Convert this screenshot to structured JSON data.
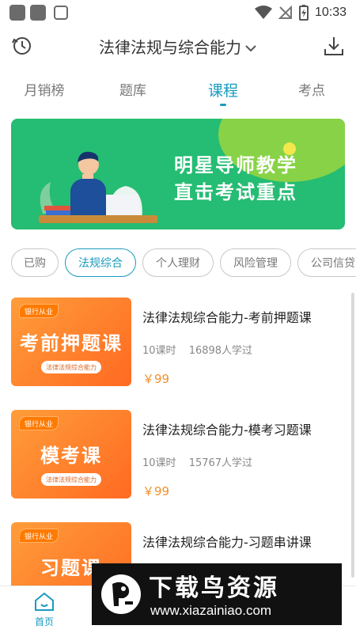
{
  "status_bar": {
    "time": "10:33",
    "icons": [
      "app-square-icon",
      "app-square-icon",
      "shield-icon",
      "wifi-icon",
      "no-signal-icon",
      "battery-charging-icon"
    ]
  },
  "header": {
    "title": "法律法规与综合能力",
    "left_icon": "history-icon",
    "right_icon": "download-icon",
    "title_chevron": "chevron-down-icon"
  },
  "tabs": [
    {
      "label": "月销榜",
      "active": false
    },
    {
      "label": "题库",
      "active": false
    },
    {
      "label": "课程",
      "active": true
    },
    {
      "label": "考点",
      "active": false
    }
  ],
  "banner": {
    "line1": "明星导师教学",
    "line2": "直击考试重点",
    "colors": {
      "background": "#25bc73",
      "accent": "#9ad63f"
    }
  },
  "filters": [
    {
      "label": "已购",
      "active": false
    },
    {
      "label": "法规综合",
      "active": true
    },
    {
      "label": "个人理财",
      "active": false
    },
    {
      "label": "风险管理",
      "active": false
    },
    {
      "label": "公司信贷",
      "active": false
    }
  ],
  "courses": [
    {
      "title": "法律法规综合能力-考前押题课",
      "lessons": "10课时",
      "learners": "16898人学过",
      "price": "￥99",
      "thumb": {
        "tag": "银行从业",
        "title": "考前押题课",
        "subtitle": "法律法规综合能力"
      }
    },
    {
      "title": "法律法规综合能力-模考习题课",
      "lessons": "10课时",
      "learners": "15767人学过",
      "price": "￥99",
      "thumb": {
        "tag": "银行从业",
        "title": "模考课",
        "subtitle": "法律法规综合能力"
      }
    },
    {
      "title": "法律法规综合能力-习题串讲课",
      "thumb": {
        "tag": "银行从业",
        "title": "习题课"
      }
    }
  ],
  "bottom_nav": [
    {
      "label": "首页",
      "icon": "home-icon",
      "active": true
    }
  ],
  "watermark": {
    "title": "下载鸟资源",
    "url": "www.xiazainiao.com"
  },
  "colors": {
    "accent": "#1a9bbf",
    "price": "#f0902c",
    "thumb": "#ff7a2a"
  }
}
